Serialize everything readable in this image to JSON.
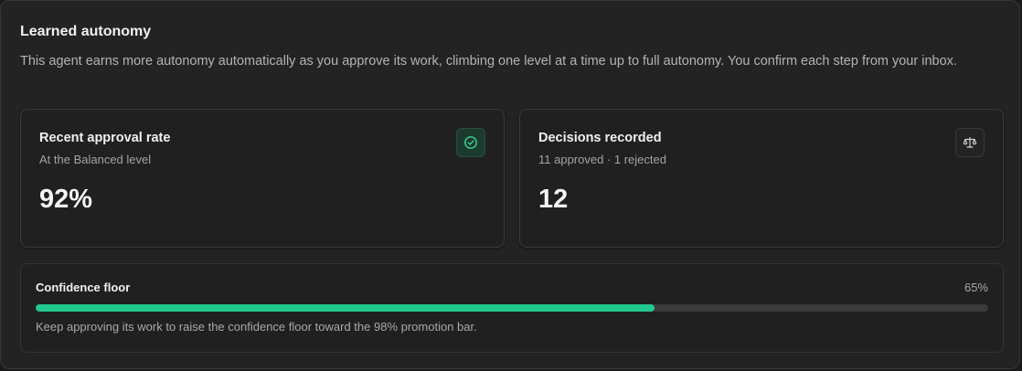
{
  "section": {
    "title": "Learned autonomy",
    "description": "This agent earns more autonomy automatically as you approve its work, climbing one level at a time up to full autonomy. You confirm each step from your inbox."
  },
  "approval_card": {
    "title": "Recent approval rate",
    "subtitle": "At the Balanced level",
    "value": "92%",
    "icon": "check-circle-icon",
    "accent_color": "#22c98e"
  },
  "decisions_card": {
    "title": "Decisions recorded",
    "subtitle": "11 approved · 1 rejected",
    "value": "12",
    "icon": "scale-icon"
  },
  "confidence_floor": {
    "label": "Confidence floor",
    "percent_label": "65%",
    "progress": 0.65,
    "bar_color": "#22c98e",
    "hint": "Keep approving its work to raise the confidence floor toward the 98% promotion bar."
  }
}
